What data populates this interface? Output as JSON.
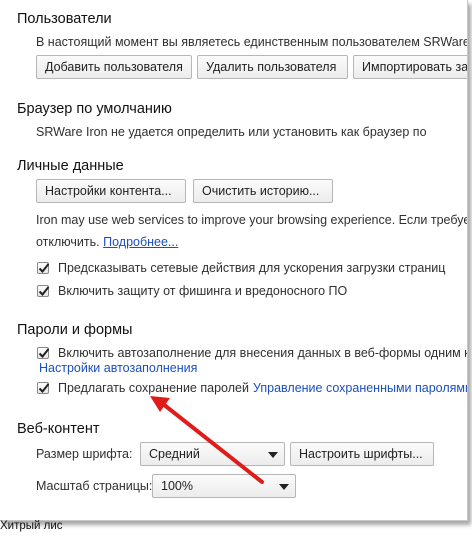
{
  "users": {
    "title": "Пользователи",
    "description": "В настоящий момент вы являетесь единственным пользователем SRWare",
    "add_button": "Добавить пользователя",
    "delete_button": "Удалить пользователя",
    "import_button": "Импортировать за"
  },
  "default_browser": {
    "title": "Браузер по умолчанию",
    "description": "SRWare Iron не удается определить или установить как браузер по"
  },
  "personal_data": {
    "title": "Личные данные",
    "content_settings_button": "Настройки контента...",
    "clear_history_button": "Очистить историю...",
    "web_services_text": "Iron may use web services to improve your browsing experience. Если требуе",
    "disable_text": "отключить.",
    "more_link": "Подробнее...",
    "checkbox_predict_label": "Предсказывать сетевые действия для ускорения загрузки страниц",
    "checkbox_phishing_label": "Включить защиту от фишинга и вредоносного ПО"
  },
  "passwords_forms": {
    "title": "Пароли и формы",
    "checkbox_autofill_label": "Включить автозаполнение для внесения данных в веб-формы одним к",
    "autofill_settings_link": "Настройки автозаполнения",
    "checkbox_save_passwords_label": "Предлагать сохранение паролей",
    "manage_passwords_link": "Управление сохраненными паролями"
  },
  "web_content": {
    "title": "Веб-контент",
    "font_size_label": "Размер шрифта:",
    "font_size_value": "Средний",
    "customize_fonts_button": "Настроить шрифты...",
    "page_zoom_label": "Масштаб страницы:",
    "page_zoom_value": "100%"
  },
  "checkboxes": {
    "predict": true,
    "phishing": true,
    "autofill": true,
    "save_passwords": true
  },
  "annotation": {
    "arrow_color": "#e01b1b"
  },
  "watermark": "Хитрый лис",
  "colors": {
    "link": "#1a4fbf",
    "arrow": "#e01b1b"
  }
}
